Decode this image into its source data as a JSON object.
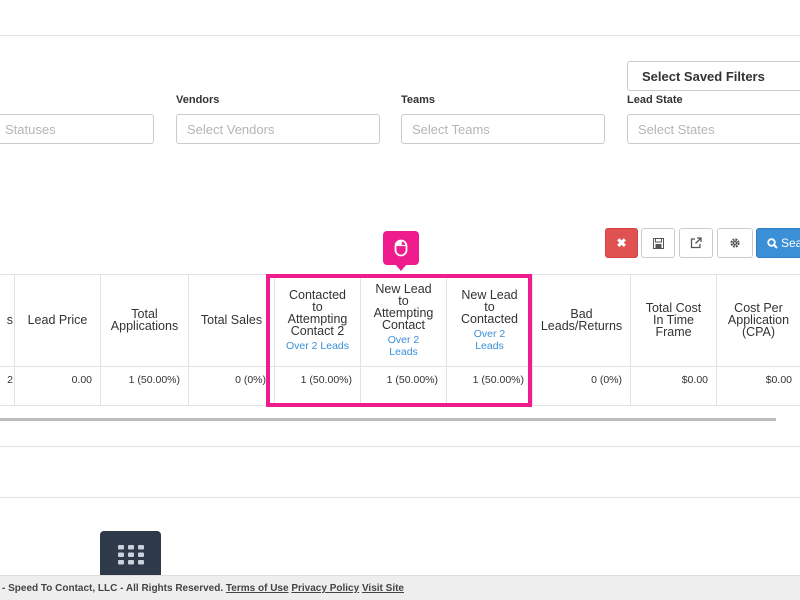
{
  "saved_filters": {
    "label": "Select Saved Filters"
  },
  "filters": {
    "statuses": {
      "placeholder": "Statuses"
    },
    "vendors": {
      "label": "Vendors",
      "placeholder": "Select Vendors"
    },
    "teams": {
      "label": "Teams",
      "placeholder": "Select Teams"
    },
    "lead_state": {
      "label": "Lead State",
      "placeholder": "Select States"
    }
  },
  "toolbar": {
    "clear_icon": "✖",
    "search_label": "Sea"
  },
  "table": {
    "columns": [
      {
        "name": "Lead Price",
        "value": "0.00"
      },
      {
        "name": "Total Applications",
        "value": "1 (50.00%)"
      },
      {
        "name": "Total Sales",
        "value": "0 (0%)"
      },
      {
        "name": "Contacted to Attempting Contact 2",
        "sub": "Over 2 Leads",
        "value": "1 (50.00%)"
      },
      {
        "name": "New Lead to Attempting Contact",
        "sub": "Over 2 Leads",
        "value": "1 (50.00%)"
      },
      {
        "name": "New Lead to Contacted",
        "sub": "Over 2 Leads",
        "value": "1 (50.00%)"
      },
      {
        "name": "Bad Leads/Returns",
        "value": "0 (0%)"
      },
      {
        "name": "Total Cost In Time Frame",
        "value": "$0.00"
      },
      {
        "name": "Cost Per Application (CPA)",
        "value": "$0.00"
      }
    ],
    "cut_first_header": "s",
    "cut_first_value": "2"
  },
  "footer": {
    "text": "- Speed To Contact, LLC - All Rights Reserved.",
    "terms": "Terms of Use",
    "privacy": "Privacy Policy",
    "visit": "Visit Site"
  },
  "colors": {
    "accent": "#3a8fd6",
    "danger": "#e05252",
    "highlight": "#ee1c8c"
  }
}
